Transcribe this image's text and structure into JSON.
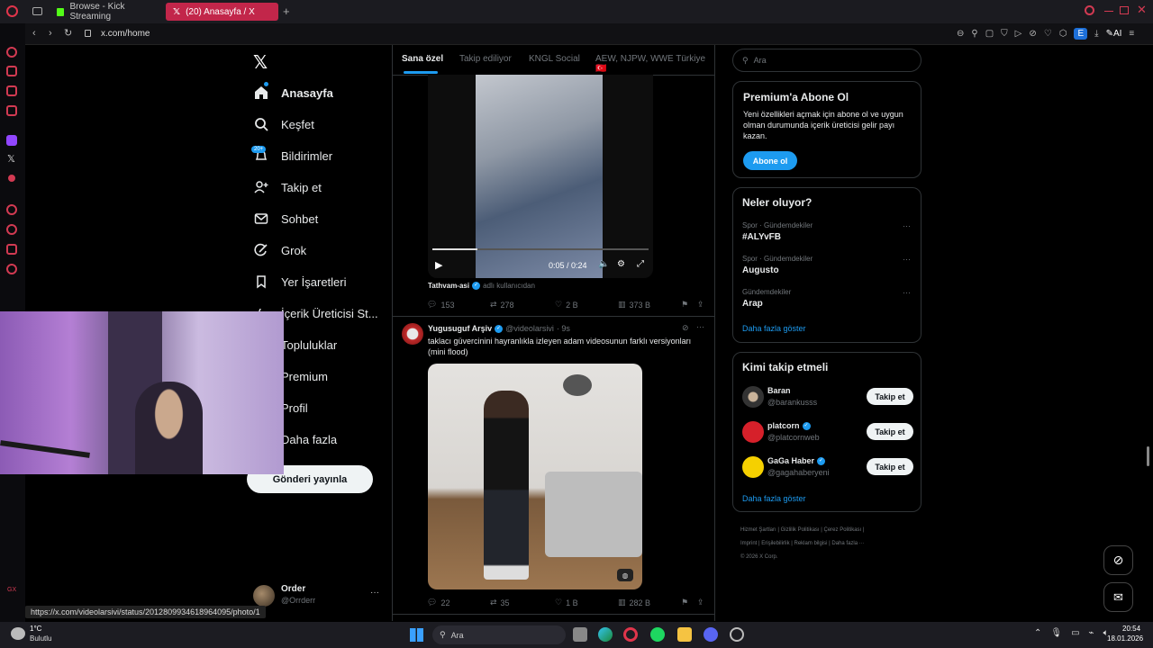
{
  "browser": {
    "tabs": [
      {
        "label": "Browse - Kick Streaming"
      },
      {
        "label": "(20) Anasayfa / X"
      }
    ],
    "url": "x.com/home",
    "ai_label": "AI",
    "ext_badge": "E"
  },
  "nav": {
    "items": [
      {
        "label": "Anasayfa",
        "icon": "home-icon"
      },
      {
        "label": "Keşfet",
        "icon": "search-icon"
      },
      {
        "label": "Bildirimler",
        "icon": "bell-icon",
        "badge": "20+"
      },
      {
        "label": "Takip et",
        "icon": "person-add-icon"
      },
      {
        "label": "Sohbet",
        "icon": "mail-icon"
      },
      {
        "label": "Grok",
        "icon": "grok-icon"
      },
      {
        "label": "Yer İşaretleri",
        "icon": "bookmark-icon"
      },
      {
        "label": "İçerik Üreticisi St...",
        "icon": "lightning-icon"
      },
      {
        "label": "Topluluklar",
        "icon": "people-icon"
      },
      {
        "label": "Premium",
        "icon": "x-icon"
      },
      {
        "label": "Profil",
        "icon": "profile-icon"
      },
      {
        "label": "Daha fazla",
        "icon": "more-icon"
      }
    ],
    "post_button": "Gönderi yayınla",
    "account": {
      "name": "Order",
      "handle": "@Orrderr"
    }
  },
  "feed": {
    "tabs": [
      "Sana özel",
      "Takip ediliyor",
      "KNGL Social",
      "AEW, NJPW, WWE Türkiye 🇹🇷"
    ],
    "post1": {
      "video_time": "0:05 / 0:24",
      "caption_user": "Tathvam-asi",
      "caption_note": "adlı kullanıcıdan",
      "replies": "153",
      "reposts": "278",
      "likes": "2 B",
      "views": "373 B"
    },
    "post2": {
      "name": "Yugusuguf Arşiv",
      "handle": "@videolarsivi",
      "time": "· 9s",
      "text": "taklacı güvercinini hayranlıkla izleyen adam videosunun farklı versiyonları (mini flood)",
      "replies": "22",
      "reposts": "35",
      "likes": "1 B",
      "views": "282 B"
    }
  },
  "right": {
    "search_placeholder": "Ara",
    "premium": {
      "title": "Premium'a Abone Ol",
      "text": "Yeni özellikleri açmak için abone ol ve uygun olman durumunda içerik üreticisi gelir payı kazan.",
      "button": "Abone ol"
    },
    "trends": {
      "title": "Neler oluyor?",
      "items": [
        {
          "sub": "Spor · Gündemdekiler",
          "name": "#ALYvFB"
        },
        {
          "sub": "Spor · Gündemdekiler",
          "name": "Augusto"
        },
        {
          "sub": "Gündemdekiler",
          "name": "Arap"
        }
      ],
      "more": "Daha fazla göster"
    },
    "who": {
      "title": "Kimi takip etmeli",
      "items": [
        {
          "name": "Baran",
          "handle": "@barankusss",
          "verified": false
        },
        {
          "name": "platcorn",
          "handle": "@platcornweb",
          "verified": true
        },
        {
          "name": "GaGa Haber",
          "handle": "@gagahaberyeni",
          "verified": true
        }
      ],
      "button": "Takip et",
      "more": "Daha fazla göster"
    },
    "footer": [
      "Hizmet Şartları",
      "Gizlilik Politikası",
      "Çerez Politikası",
      "Imprint",
      "Erişilebilirlik",
      "Reklam bilgisi",
      "Daha fazla ···",
      "© 2026 X Corp."
    ]
  },
  "status_url": "https://x.com/videolarsivi/status/2012809934618964095/photo/1",
  "taskbar": {
    "weather_temp": "1°C",
    "weather_desc": "Bulutlu",
    "search": "Ara",
    "time": "20:54",
    "date": "18.01.2026"
  },
  "colors": {
    "accent": "#1d9bf0",
    "bg": "#000000",
    "opera_red": "#d23a52"
  }
}
